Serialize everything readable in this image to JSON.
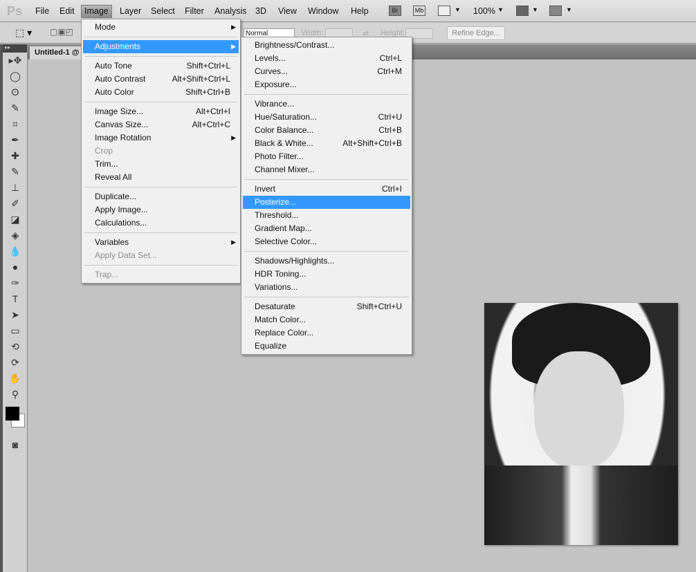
{
  "menubar": {
    "logo": "Ps",
    "items": [
      "File",
      "Edit",
      "Image",
      "Layer",
      "Select",
      "Filter",
      "Analysis",
      "3D",
      "View",
      "Window",
      "Help"
    ],
    "active": "Image",
    "br": "Br",
    "mb": "Mb",
    "zoom": "100%"
  },
  "options": {
    "mode": "Normal",
    "width_label": "Width:",
    "height_label": "Height:",
    "refine": "Refine Edge..."
  },
  "document": {
    "tab": "Untitled-1 @"
  },
  "image_menu": [
    {
      "label": "Mode",
      "sub": true
    },
    {
      "sep": true
    },
    {
      "label": "Adjustments",
      "sub": true,
      "hl": true
    },
    {
      "sep": true
    },
    {
      "label": "Auto Tone",
      "sc": "Shift+Ctrl+L"
    },
    {
      "label": "Auto Contrast",
      "sc": "Alt+Shift+Ctrl+L"
    },
    {
      "label": "Auto Color",
      "sc": "Shift+Ctrl+B"
    },
    {
      "sep": true
    },
    {
      "label": "Image Size...",
      "sc": "Alt+Ctrl+I"
    },
    {
      "label": "Canvas Size...",
      "sc": "Alt+Ctrl+C"
    },
    {
      "label": "Image Rotation",
      "sub": true
    },
    {
      "label": "Crop",
      "dis": true
    },
    {
      "label": "Trim..."
    },
    {
      "label": "Reveal All"
    },
    {
      "sep": true
    },
    {
      "label": "Duplicate..."
    },
    {
      "label": "Apply Image..."
    },
    {
      "label": "Calculations..."
    },
    {
      "sep": true
    },
    {
      "label": "Variables",
      "sub": true
    },
    {
      "label": "Apply Data Set...",
      "dis": true
    },
    {
      "sep": true
    },
    {
      "label": "Trap...",
      "dis": true
    }
  ],
  "adjustments_menu": [
    {
      "label": "Brightness/Contrast..."
    },
    {
      "label": "Levels...",
      "sc": "Ctrl+L"
    },
    {
      "label": "Curves...",
      "sc": "Ctrl+M"
    },
    {
      "label": "Exposure..."
    },
    {
      "sep": true
    },
    {
      "label": "Vibrance..."
    },
    {
      "label": "Hue/Saturation...",
      "sc": "Ctrl+U"
    },
    {
      "label": "Color Balance...",
      "sc": "Ctrl+B"
    },
    {
      "label": "Black & White...",
      "sc": "Alt+Shift+Ctrl+B"
    },
    {
      "label": "Photo Filter..."
    },
    {
      "label": "Channel Mixer..."
    },
    {
      "sep": true
    },
    {
      "label": "Invert",
      "sc": "Ctrl+I"
    },
    {
      "label": "Posterize...",
      "hl": true
    },
    {
      "label": "Threshold..."
    },
    {
      "label": "Gradient Map..."
    },
    {
      "label": "Selective Color..."
    },
    {
      "sep": true
    },
    {
      "label": "Shadows/Highlights..."
    },
    {
      "label": "HDR Toning..."
    },
    {
      "label": "Variations..."
    },
    {
      "sep": true
    },
    {
      "label": "Desaturate",
      "sc": "Shift+Ctrl+U"
    },
    {
      "label": "Match Color..."
    },
    {
      "label": "Replace Color..."
    },
    {
      "label": "Equalize"
    }
  ],
  "tools": [
    "move",
    "marquee",
    "lasso",
    "quick-select",
    "crop",
    "eyedropper",
    "healing",
    "brush",
    "stamp",
    "history-brush",
    "eraser",
    "paint-bucket",
    "blur",
    "dodge",
    "pen",
    "type",
    "path-select",
    "shape",
    "3d-rotate",
    "3d-orbit",
    "hand",
    "zoom"
  ]
}
